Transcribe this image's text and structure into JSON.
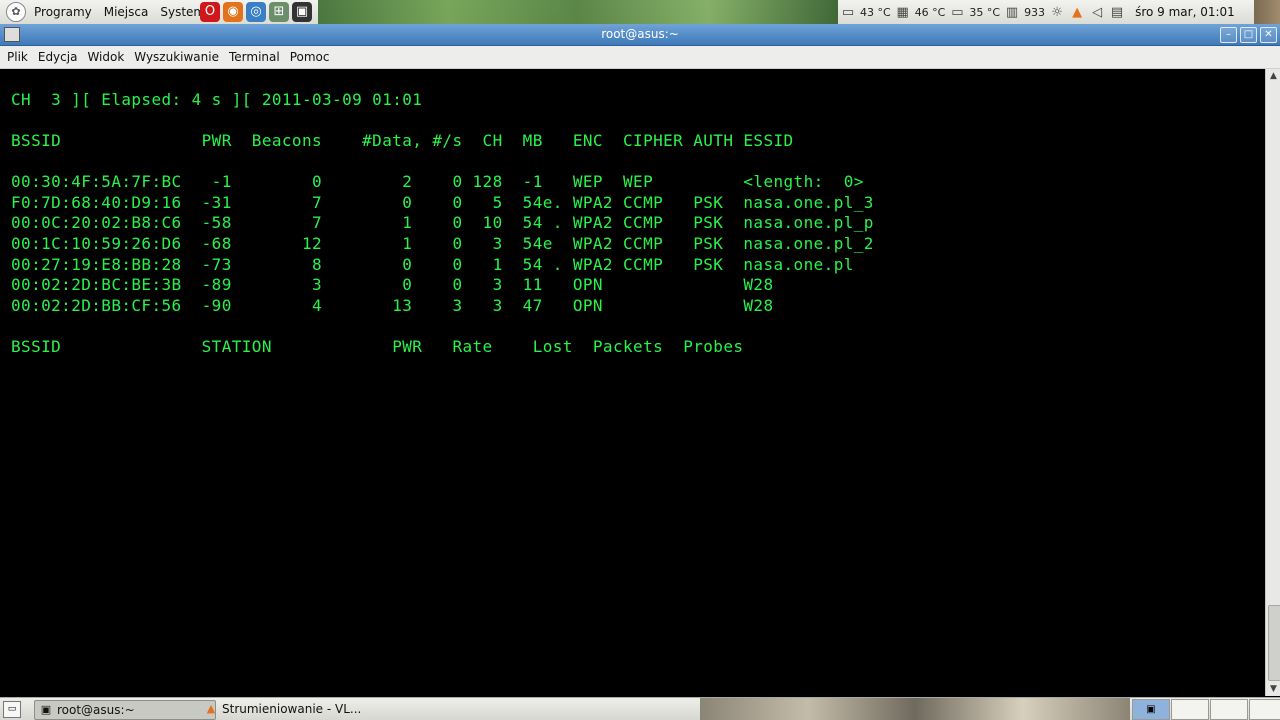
{
  "top_panel": {
    "menus": [
      "Programy",
      "Miejsca",
      "System"
    ],
    "launchers": [
      {
        "icon": "opera-icon",
        "glyph": "O",
        "color": "#d0171b"
      },
      {
        "icon": "firefox-icon",
        "glyph": "◉",
        "color": "#e2731c"
      },
      {
        "icon": "browser-icon",
        "glyph": "◎",
        "color": "#3b7fc4"
      },
      {
        "icon": "network-icon",
        "glyph": "⊞",
        "color": "#6b8e6b"
      },
      {
        "icon": "terminal-icon",
        "glyph": "▣",
        "color": "#333333"
      }
    ],
    "tray": {
      "temp1": "43 °C",
      "temp2": "46 °C",
      "temp3": "35 °C",
      "cpu_freq": "933",
      "clock": "śro  9 mar, 01:01"
    }
  },
  "window": {
    "title": "root@asus:~"
  },
  "menubar": [
    "Plik",
    "Edycja",
    "Widok",
    "Wyszukiwanie",
    "Terminal",
    "Pomoc"
  ],
  "terminal": {
    "lines": [
      "CH  3 ][ Elapsed: 4 s ][ 2011-03-09 01:01",
      "BSSID              PWR  Beacons    #Data, #/s  CH  MB   ENC  CIPHER AUTH ESSID",
      "00:30:4F:5A:7F:BC   -1        0        2    0 128  -1   WEP  WEP         <length:  0>",
      "F0:7D:68:40:D9:16  -31        7        0    0   5  54e. WPA2 CCMP   PSK  nasa.one.pl_3",
      "00:0C:20:02:B8:C6  -58        7        1    0  10  54 . WPA2 CCMP   PSK  nasa.one.pl_p",
      "00:1C:10:59:26:D6  -68       12        1    0   3  54e  WPA2 CCMP   PSK  nasa.one.pl_2",
      "00:27:19:E8:BB:28  -73        8        0    0   1  54 . WPA2 CCMP   PSK  nasa.one.pl",
      "00:02:2D:BC:BE:3B  -89        3        0    0   3  11   OPN              W28",
      "00:02:2D:BB:CF:56  -90        4       13    3   3  47   OPN              W28",
      "BSSID              STATION            PWR   Rate    Lost  Packets  Probes"
    ]
  },
  "taskbar": {
    "tasks": [
      "root@asus:~",
      "Strumieniowanie - VL..."
    ]
  }
}
